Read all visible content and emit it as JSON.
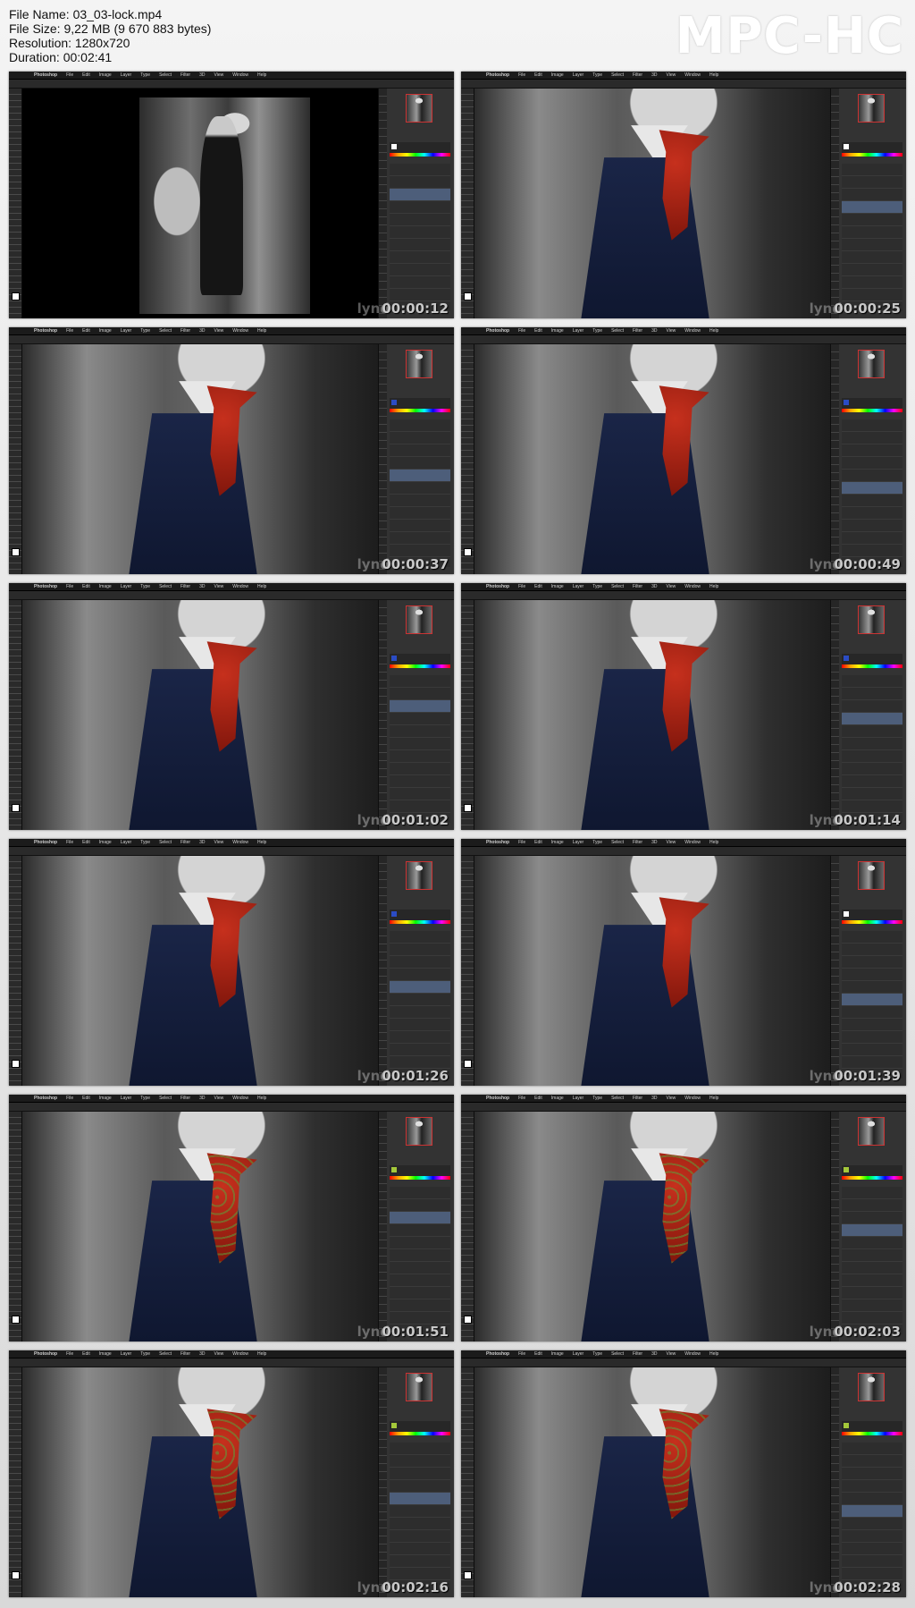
{
  "file_info": {
    "name": "File Name: 03_03-lock.mp4",
    "size": "File Size: 9,22 MB (9 670 883 bytes)",
    "resolution": "Resolution: 1280x720",
    "duration": "Duration: 00:02:41"
  },
  "brand": "MPC-HC",
  "app_menu": {
    "apple": "",
    "items": [
      "Photoshop",
      "File",
      "Edit",
      "Image",
      "Layer",
      "Type",
      "Select",
      "Filter",
      "3D",
      "View",
      "Window",
      "Help"
    ]
  },
  "watermark": "lynd",
  "thumbnails": [
    {
      "time": "00:00:12",
      "view": "full",
      "colors": "white",
      "tie": "plain"
    },
    {
      "time": "00:00:25",
      "view": "zoom",
      "colors": "white",
      "tie": "plain"
    },
    {
      "time": "00:00:37",
      "view": "zoom",
      "colors": "blue",
      "tie": "plain"
    },
    {
      "time": "00:00:49",
      "view": "zoom",
      "colors": "blue",
      "tie": "plain"
    },
    {
      "time": "00:01:02",
      "view": "zoom",
      "colors": "blue",
      "tie": "plain"
    },
    {
      "time": "00:01:14",
      "view": "zoom",
      "colors": "blue",
      "tie": "plain"
    },
    {
      "time": "00:01:26",
      "view": "zoom",
      "colors": "blue",
      "tie": "plain"
    },
    {
      "time": "00:01:39",
      "view": "zoom",
      "colors": "white",
      "tie": "plain"
    },
    {
      "time": "00:01:51",
      "view": "zoom",
      "colors": "green",
      "tie": "green"
    },
    {
      "time": "00:02:03",
      "view": "zoom",
      "colors": "green",
      "tie": "green"
    },
    {
      "time": "00:02:16",
      "view": "zoom",
      "colors": "green",
      "tie": "green"
    },
    {
      "time": "00:02:28",
      "view": "zoom",
      "colors": "green",
      "tie": "green"
    }
  ]
}
